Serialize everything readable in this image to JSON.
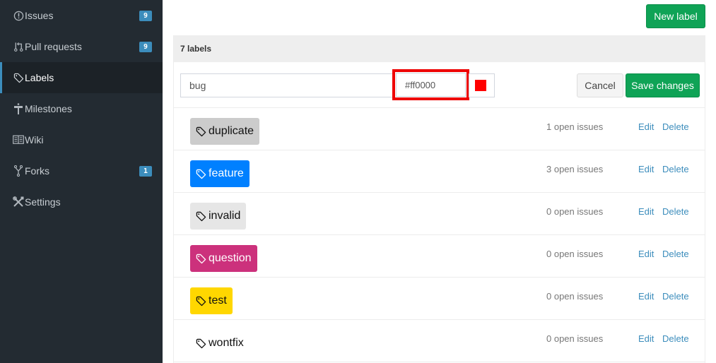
{
  "sidebar": {
    "items": [
      {
        "label": "Issues",
        "icon": "exclamation-circle-icon",
        "badge": "9",
        "active": false
      },
      {
        "label": "Pull requests",
        "icon": "pull-request-icon",
        "badge": "9",
        "active": false
      },
      {
        "label": "Labels",
        "icon": "tag-icon",
        "badge": null,
        "active": true
      },
      {
        "label": "Milestones",
        "icon": "milestone-signpost-icon",
        "badge": null,
        "active": false
      },
      {
        "label": "Wiki",
        "icon": "book-icon",
        "badge": null,
        "active": false
      },
      {
        "label": "Forks",
        "icon": "fork-icon",
        "badge": "1",
        "active": false
      },
      {
        "label": "Settings",
        "icon": "tools-icon",
        "badge": null,
        "active": false
      }
    ]
  },
  "toolbar": {
    "new_label": "New label"
  },
  "panel": {
    "header": "7 labels",
    "edit_form": {
      "name_value": "bug",
      "color_value": "#ff0000",
      "preview_color": "#ff0000",
      "cancel_label": "Cancel",
      "save_label": "Save changes"
    },
    "labels": [
      {
        "name": "duplicate",
        "bg": "#cccccc",
        "fg": "#111111",
        "issues": "1 open issues",
        "edit": "Edit",
        "delete": "Delete"
      },
      {
        "name": "feature",
        "bg": "#0080ff",
        "fg": "#ffffff",
        "issues": "3 open issues",
        "edit": "Edit",
        "delete": "Delete"
      },
      {
        "name": "invalid",
        "bg": "#e6e6e6",
        "fg": "#111111",
        "issues": "0 open issues",
        "edit": "Edit",
        "delete": "Delete"
      },
      {
        "name": "question",
        "bg": "#cc317c",
        "fg": "#ffffff",
        "issues": "0 open issues",
        "edit": "Edit",
        "delete": "Delete"
      },
      {
        "name": "test",
        "bg": "#ffd700",
        "fg": "#111111",
        "issues": "0 open issues",
        "edit": "Edit",
        "delete": "Delete"
      },
      {
        "name": "wontfix",
        "bg": "#ffffff",
        "fg": "#111111",
        "issues": "0 open issues",
        "edit": "Edit",
        "delete": "Delete"
      }
    ]
  }
}
